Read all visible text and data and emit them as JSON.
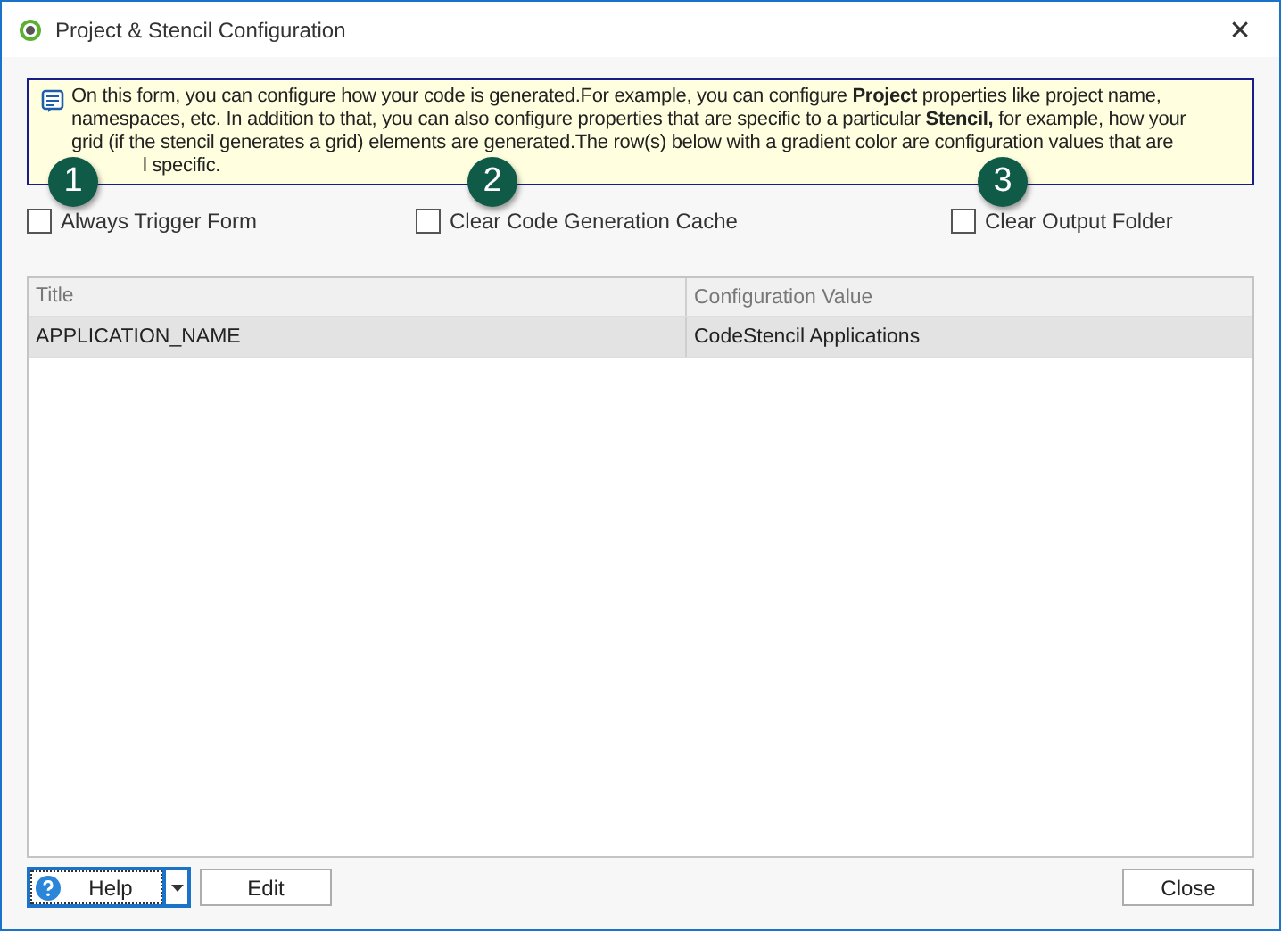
{
  "window": {
    "title": "Project & Stencil Configuration",
    "close": "✕"
  },
  "info": {
    "lines": [
      "On this form, you can configure how your code is generated.For example, you can configure **Project** properties like project name,",
      "namespaces, etc. In addition to that, you can also configure properties that are specific to a particular **Stencil,** for example, how your",
      "grid (if the stencil generates a grid) elements are generated.The row(s) below with a gradient color are configuration values that are",
      "l specific."
    ]
  },
  "callouts": [
    "1",
    "2",
    "3"
  ],
  "options": [
    {
      "label": "Always Trigger Form",
      "checked": false
    },
    {
      "label": "Clear Code Generation Cache",
      "checked": false
    },
    {
      "label": "Clear Output Folder",
      "checked": false
    }
  ],
  "table": {
    "columns": [
      "Title",
      "Configuration Value"
    ],
    "rows": [
      {
        "cells": [
          "APPLICATION_NAME",
          "CodeStencil Applications"
        ],
        "selected": true
      }
    ]
  },
  "buttons": {
    "help": "Help",
    "edit": "Edit",
    "close": "Close"
  }
}
